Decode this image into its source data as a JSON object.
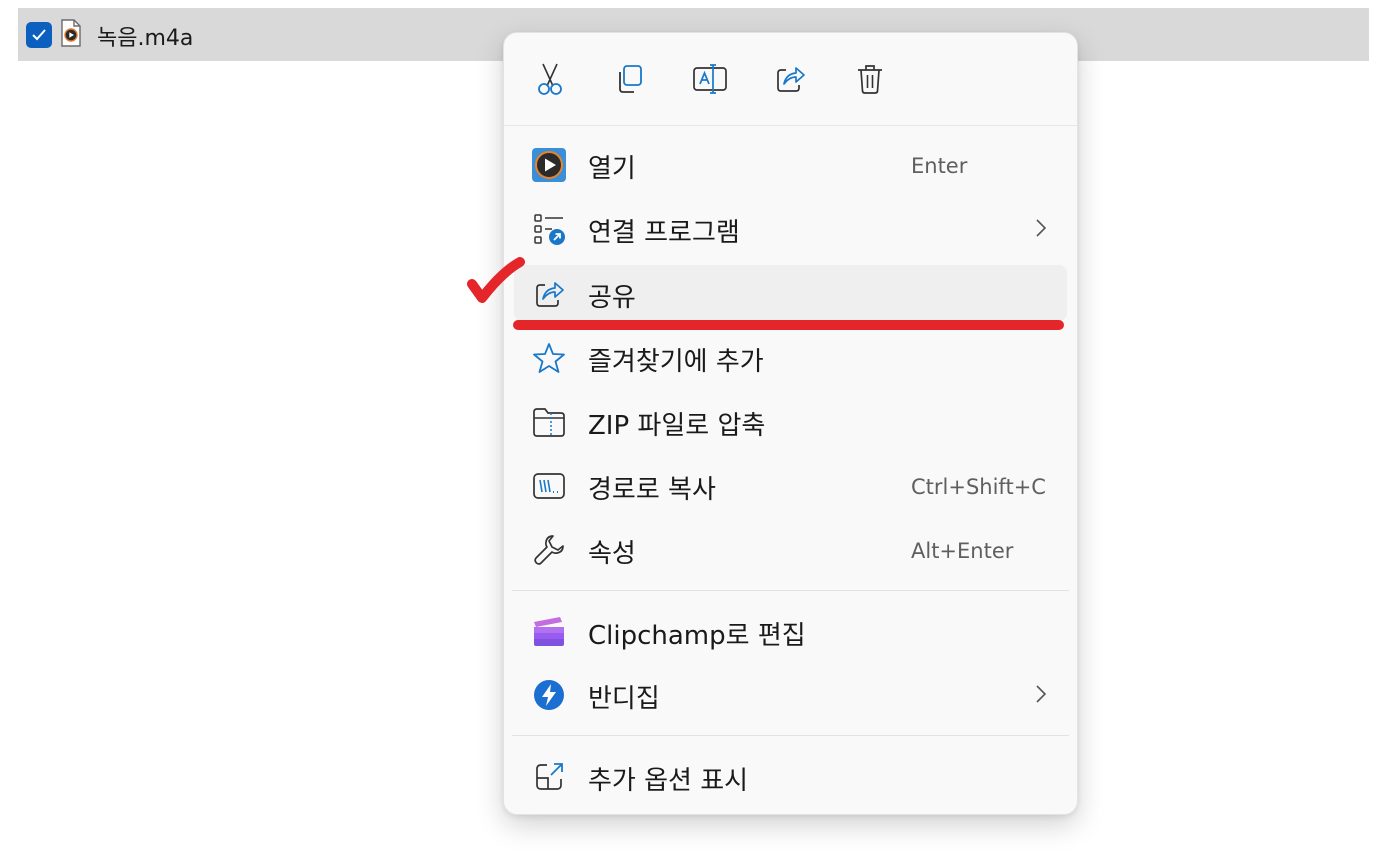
{
  "file": {
    "name": "녹음.m4a",
    "checked": true,
    "icon": "media-file-icon"
  },
  "toolbar": [
    {
      "name": "cut",
      "icon": "scissors-icon"
    },
    {
      "name": "copy",
      "icon": "copy-icon"
    },
    {
      "name": "rename",
      "icon": "rename-icon"
    },
    {
      "name": "share",
      "icon": "share-icon"
    },
    {
      "name": "delete",
      "icon": "trash-icon"
    }
  ],
  "menu": {
    "items": [
      {
        "label": "열기",
        "shortcut": "Enter",
        "icon": "media-player-icon"
      },
      {
        "label": "연결 프로그램",
        "icon": "open-with-icon",
        "submenu": true
      },
      {
        "label": "공유",
        "icon": "share-icon",
        "highlighted": true
      },
      {
        "label": "즐겨찾기에 추가",
        "icon": "star-icon"
      },
      {
        "label": "ZIP 파일로 압축",
        "icon": "zip-folder-icon"
      },
      {
        "label": "경로로 복사",
        "shortcut": "Ctrl+Shift+C",
        "icon": "copy-path-icon"
      },
      {
        "label": "속성",
        "shortcut": "Alt+Enter",
        "icon": "wrench-icon"
      },
      {
        "label": "Clipchamp로 편집",
        "icon": "clipchamp-icon"
      },
      {
        "label": "반디집",
        "icon": "bandizip-icon",
        "submenu": true
      },
      {
        "label": "추가 옵션 표시",
        "icon": "more-options-icon"
      }
    ]
  },
  "colors": {
    "accent": "#0b5fbf",
    "highlight_red": "#e4262b",
    "menu_bg": "#f9f9f9",
    "selection_bg": "#d9d9d9"
  }
}
